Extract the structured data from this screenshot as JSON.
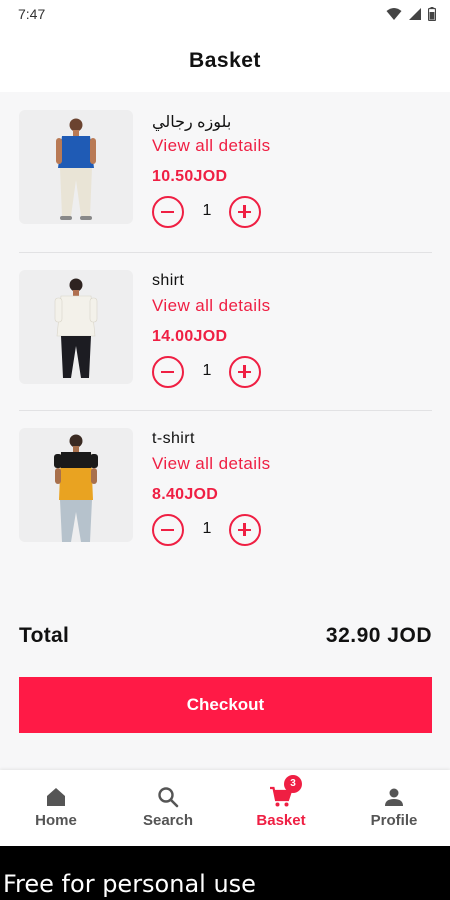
{
  "status_bar": {
    "time": "7:47"
  },
  "header": {
    "title": "Basket"
  },
  "items": [
    {
      "name": "بلوزه رجالي",
      "details_link": "View all details",
      "price": "10.50JOD",
      "quantity": "1",
      "shirt_color": "#1f5bb5",
      "pants_color": "#e9e4d6"
    },
    {
      "name": "shirt",
      "details_link": "View all details",
      "price": "14.00JOD",
      "quantity": "1",
      "shirt_color": "#f3f1ea",
      "pants_color": "#1c1c22"
    },
    {
      "name": "t-shirt",
      "details_link": "View all details",
      "price": "8.40JOD",
      "quantity": "1",
      "shirt_color": "#e9a321",
      "pants_color": "#b6c2cc"
    }
  ],
  "summary": {
    "total_label": "Total",
    "total_value": "32.90 JOD"
  },
  "checkout": {
    "label": "Checkout"
  },
  "bottom_nav": {
    "items": [
      {
        "label": "Home",
        "icon": "home-icon"
      },
      {
        "label": "Search",
        "icon": "search-icon"
      },
      {
        "label": "Basket",
        "icon": "cart-icon",
        "badge": "3",
        "active": true
      },
      {
        "label": "Profile",
        "icon": "person-icon"
      }
    ]
  },
  "watermark": {
    "text": "Free for personal use"
  },
  "colors": {
    "accent": "#ef1f43",
    "button": "#ff1a46",
    "background": "#f7f7f8"
  }
}
